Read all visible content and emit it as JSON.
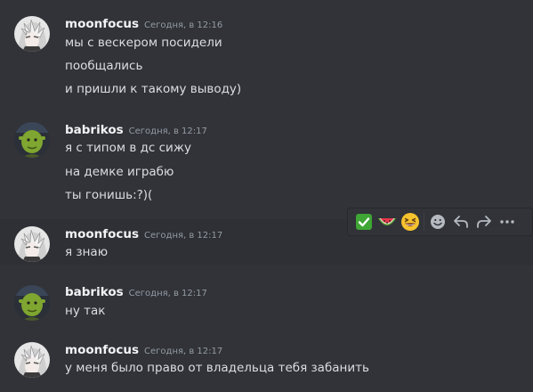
{
  "messages": [
    {
      "username": "moonfocus",
      "timestamp": "Сегодня, в 12:16",
      "avatar_icon": "moonfocus-avatar-icon",
      "lines": [
        "мы с вескером посидели",
        "пообщались",
        "и пришли к такому выводу)"
      ]
    },
    {
      "username": "babrikos",
      "timestamp": "Сегодня, в 12:17",
      "avatar_icon": "shrek-avatar-icon",
      "lines": [
        "я с типом в дс сижу",
        "на демке играбю",
        "ты гонишь:?)("
      ]
    },
    {
      "username": "moonfocus",
      "timestamp": "Сегодня, в 12:17",
      "avatar_icon": "moonfocus-avatar-icon",
      "lines": [
        "я знаю"
      ]
    },
    {
      "username": "babrikos",
      "timestamp": "Сегодня, в 12:17",
      "avatar_icon": "shrek-avatar-icon",
      "lines": [
        "ну так"
      ]
    },
    {
      "username": "moonfocus",
      "timestamp": "Сегодня, в 12:17",
      "avatar_icon": "moonfocus-avatar-icon",
      "lines": [
        "у меня было право от владельца тебя забанить"
      ]
    }
  ],
  "hover_toolbar": {
    "quick_reactions": [
      {
        "icon": "check-mark-emoji-icon"
      },
      {
        "icon": "watermelon-emoji-icon"
      },
      {
        "icon": "laughing-emoji-icon"
      }
    ],
    "actions": [
      {
        "icon": "add-reaction-icon"
      },
      {
        "icon": "reply-icon"
      },
      {
        "icon": "forward-icon"
      },
      {
        "icon": "more-options-icon"
      }
    ]
  },
  "colors": {
    "background": "#313338",
    "username": "#f2f3f5",
    "message_text": "#dbdee1",
    "timestamp": "#949ba4"
  }
}
